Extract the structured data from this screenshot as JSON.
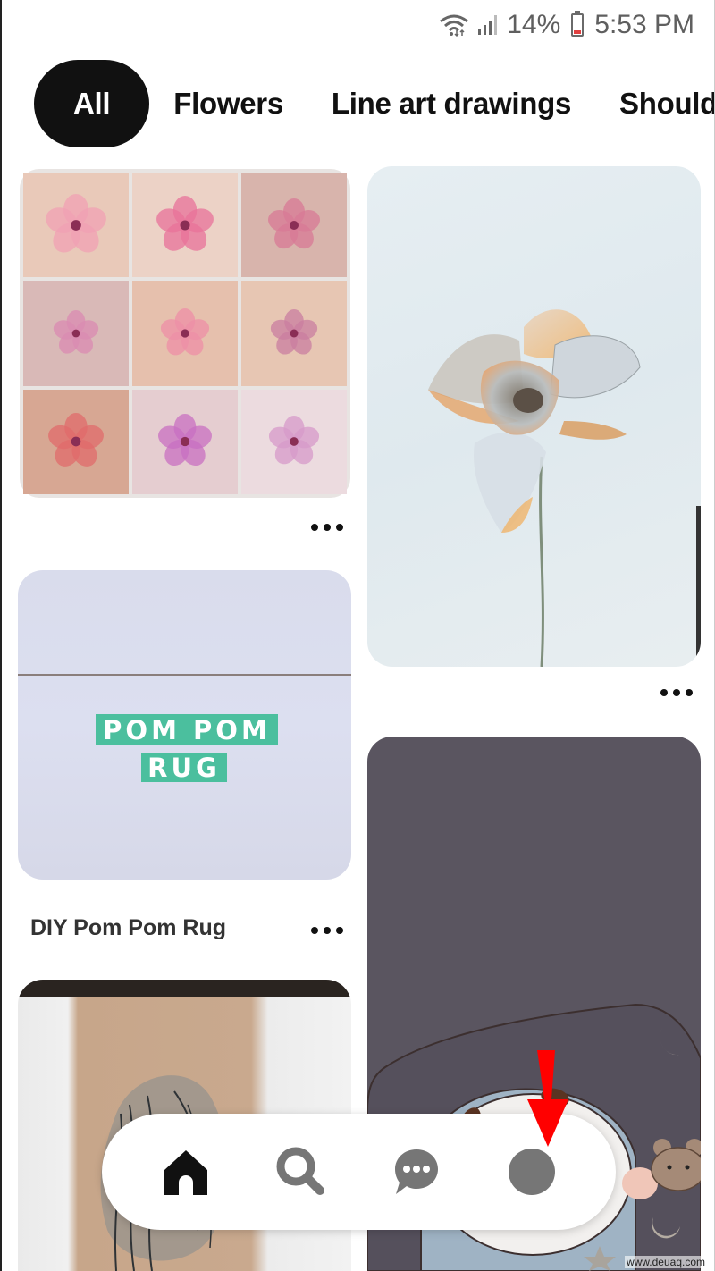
{
  "status_bar": {
    "battery_percent": "14%",
    "battery_level": 0.14,
    "time": "5:53 PM",
    "icons": [
      "wifi-icon",
      "signal-icon",
      "battery-icon"
    ]
  },
  "filters": {
    "chips": [
      {
        "label": "All",
        "active": true
      },
      {
        "label": "Flowers",
        "active": false
      },
      {
        "label": "Line art drawings",
        "active": false
      },
      {
        "label": "Shoulder",
        "active": false
      }
    ]
  },
  "pins": [
    {
      "id": "cherry-blossom-tattoos",
      "title": "",
      "image_desc": "Grid of cherry blossom tattoos",
      "column": "left"
    },
    {
      "id": "watercolor-flower",
      "title": "",
      "image_desc": "Pastel watercolor flower",
      "column": "right"
    },
    {
      "id": "pom-pom-rug",
      "title": "DIY Pom Pom Rug",
      "image_text": [
        "POM POM",
        "RUG"
      ],
      "image_desc": "Pom pom rug tutorial cover",
      "column": "left"
    },
    {
      "id": "cartoon-wallpaper",
      "title": "",
      "image_desc": "Cute cartoon sleeping in bed wallpaper",
      "column": "right"
    },
    {
      "id": "portrait-tattoo",
      "title": "",
      "image_desc": "Portrait line tattoo on arm",
      "column": "left"
    }
  ],
  "bottom_nav": {
    "items": [
      {
        "name": "home",
        "icon": "home-icon",
        "active": true
      },
      {
        "name": "search",
        "icon": "search-icon",
        "active": false
      },
      {
        "name": "messages",
        "icon": "chat-icon",
        "active": false
      },
      {
        "name": "profile",
        "icon": "profile-avatar-icon",
        "active": false
      }
    ]
  },
  "annotation": {
    "type": "red-arrow",
    "target": "profile"
  },
  "colors": {
    "active_chip": "#111111",
    "nav_active": "#111111",
    "nav_inactive": "#767676",
    "pom_tag": "#4bbf9e",
    "arrow": "#ff0000"
  },
  "watermark": "www.deuaq.com"
}
